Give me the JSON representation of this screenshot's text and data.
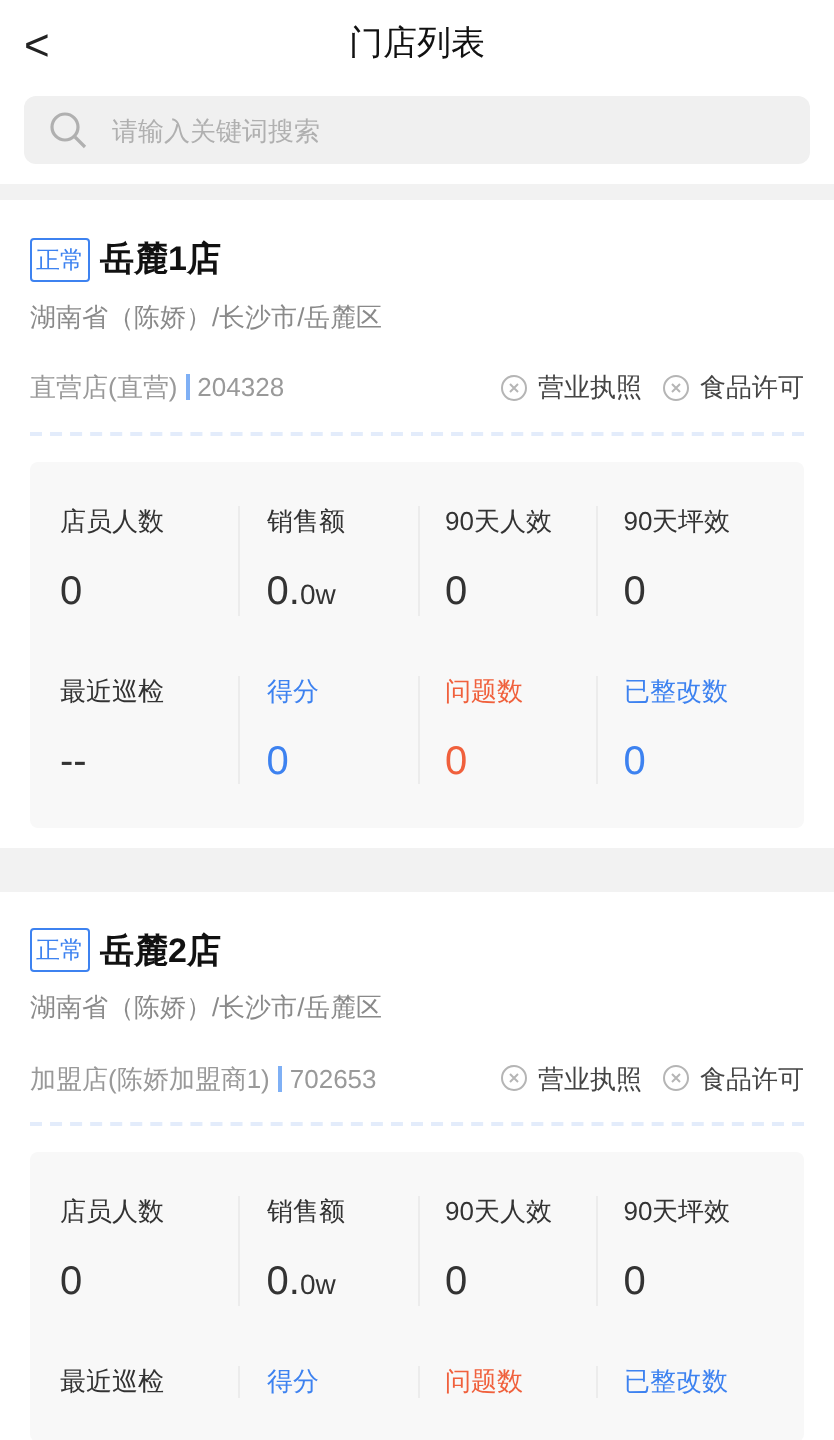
{
  "header": {
    "back": "<",
    "title": "门店列表"
  },
  "search": {
    "placeholder": "请输入关键词搜索"
  },
  "stores": [
    {
      "status": "正常",
      "name": "岳麓1店",
      "region": "湖南省（陈娇）/长沙市/岳麓区",
      "type": "直营店(直营)",
      "code": "204328",
      "licenses": [
        {
          "label": "营业执照",
          "valid": false
        },
        {
          "label": "食品许可",
          "valid": false
        }
      ],
      "metrics": [
        [
          {
            "label": "店员人数",
            "value": "0",
            "color": "#333333"
          },
          {
            "label": "销售额",
            "value": "0.",
            "suffix": "0w",
            "color": "#333333"
          },
          {
            "label": "90天人效",
            "value": "0",
            "color": "#333333"
          },
          {
            "label": "90天坪效",
            "value": "0",
            "color": "#333333"
          }
        ],
        [
          {
            "label": "最近巡检",
            "value": "--",
            "color": "#333333"
          },
          {
            "label": "得分",
            "value": "0",
            "color": "#3d82f0"
          },
          {
            "label": "问题数",
            "value": "0",
            "color": "#f0603c"
          },
          {
            "label": "已整改数",
            "value": "0",
            "color": "#3d82f0"
          }
        ]
      ]
    },
    {
      "status": "正常",
      "name": "岳麓2店",
      "region": "湖南省（陈娇）/长沙市/岳麓区",
      "type": "加盟店(陈娇加盟商1)",
      "code": "702653",
      "licenses": [
        {
          "label": "营业执照",
          "valid": false
        },
        {
          "label": "食品许可",
          "valid": false
        }
      ],
      "metrics": [
        [
          {
            "label": "店员人数",
            "value": "0",
            "color": "#333333"
          },
          {
            "label": "销售额",
            "value": "0.",
            "suffix": "0w",
            "color": "#333333"
          },
          {
            "label": "90天人效",
            "value": "0",
            "color": "#333333"
          },
          {
            "label": "90天坪效",
            "value": "0",
            "color": "#333333"
          }
        ],
        [
          {
            "label": "最近巡检",
            "color": "#333333"
          },
          {
            "label": "得分",
            "color": "#3d82f0"
          },
          {
            "label": "问题数",
            "color": "#f0603c"
          },
          {
            "label": "已整改数",
            "color": "#3d82f0"
          }
        ]
      ]
    }
  ]
}
